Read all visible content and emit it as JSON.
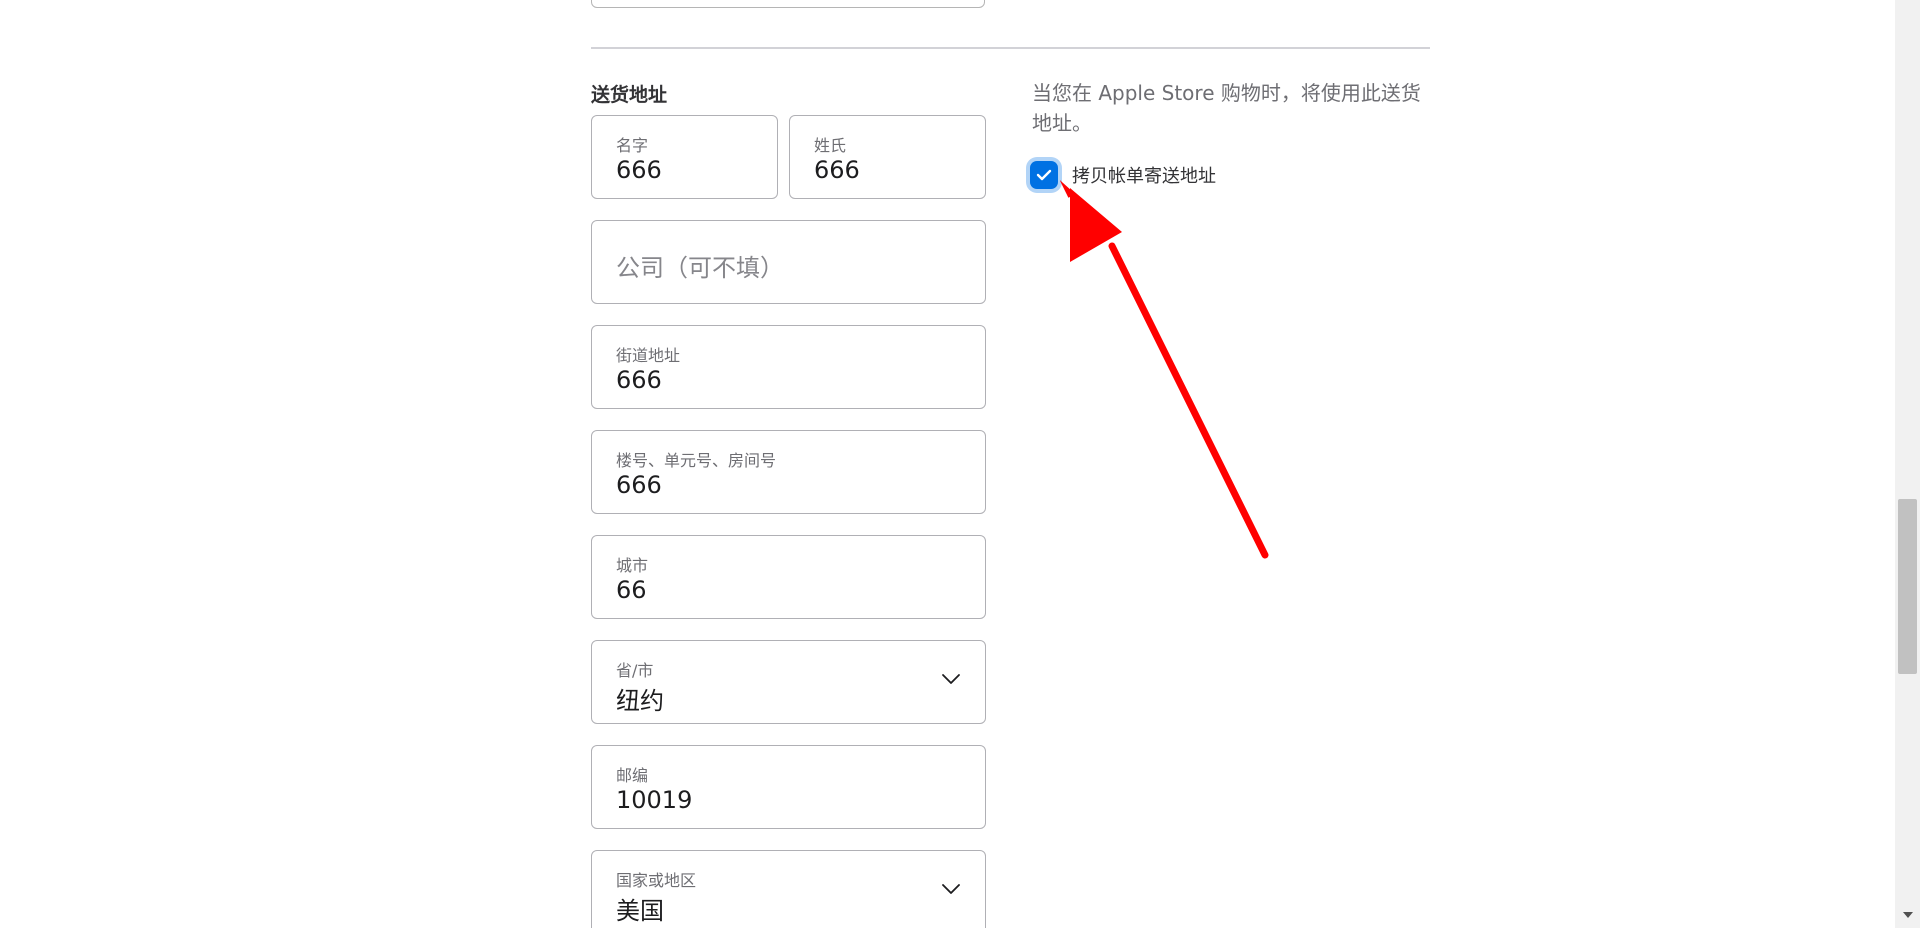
{
  "shipping": {
    "section_title": "送货地址",
    "first_name": {
      "label": "名字",
      "value": "666"
    },
    "last_name": {
      "label": "姓氏",
      "value": "666"
    },
    "company": {
      "placeholder": "公司（可不填）"
    },
    "street": {
      "label": "街道地址",
      "value": "666"
    },
    "unit": {
      "label": "楼号、单元号、房间号",
      "value": "666"
    },
    "city": {
      "label": "城市",
      "value": "66"
    },
    "state": {
      "label": "省/市",
      "value": "纽约"
    },
    "zip": {
      "label": "邮编",
      "value": "10019"
    },
    "country": {
      "label": "国家或地区",
      "value": "美国"
    }
  },
  "info": {
    "text": "当您在 Apple Store 购物时，将使用此送货地址。"
  },
  "copy_billing": {
    "label": "拷贝帐单寄送地址",
    "checked": true
  },
  "colors": {
    "accent": "#0071e3",
    "annotation_arrow": "#ff0000",
    "border": "#b0b0b5"
  },
  "icons": {
    "checkbox": "checkmark-icon",
    "select": "chevron-down-icon",
    "annotation": "red-arrow-icon"
  }
}
